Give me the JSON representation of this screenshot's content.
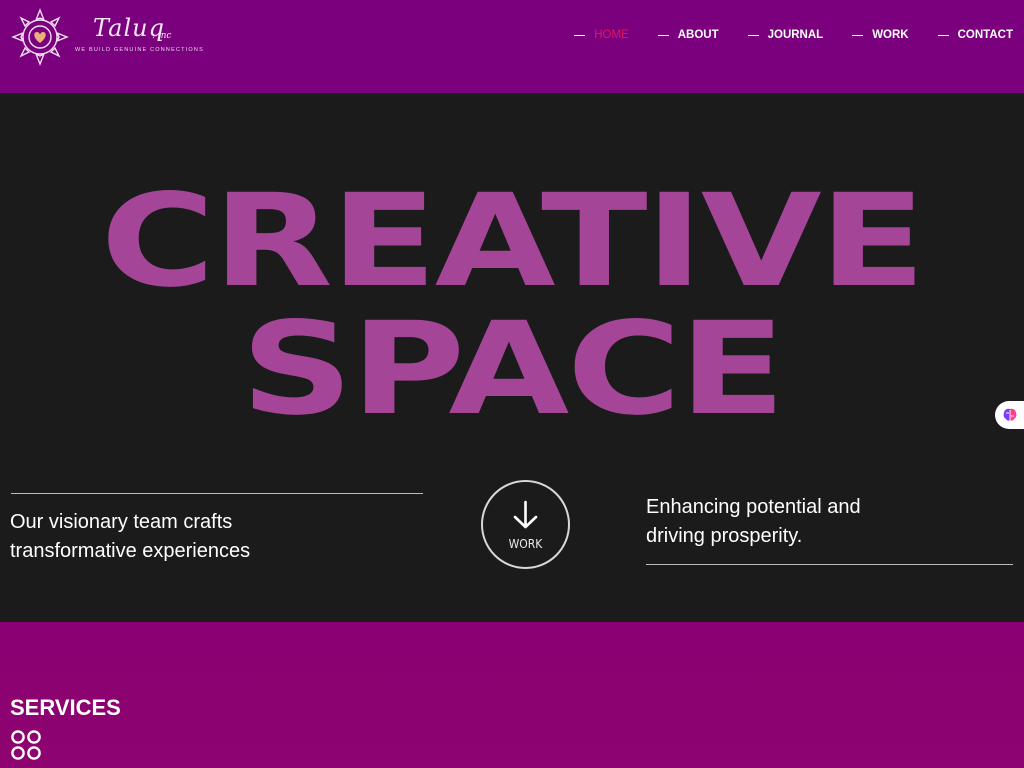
{
  "brand": {
    "name": "Taluq",
    "suffix": ". inc",
    "tagline": "WE BUILD GENUINE CONNECTIONS",
    "accent": "#7a007e",
    "logo_icon": "mandala-icon"
  },
  "nav": {
    "items": [
      {
        "label": "HOME",
        "active": true
      },
      {
        "label": "ABOUT",
        "active": false
      },
      {
        "label": "JOURNAL",
        "active": false
      },
      {
        "label": "WORK",
        "active": false
      },
      {
        "label": "CONTACT",
        "active": false
      }
    ],
    "active_color": "#e4145c"
  },
  "hero": {
    "line1": "CREATIVE",
    "line2": "SPACE",
    "title_color": "#a44598",
    "background": "#1b1b1b",
    "left_text_1": "Our visionary team crafts",
    "left_text_2": "transformative experiences",
    "right_text_1": "Enhancing potential and",
    "right_text_2": "driving prosperity.",
    "work_button": {
      "label": "WORK",
      "icon": "arrow-down-icon"
    }
  },
  "side_widget": {
    "icon": "brain-icon"
  },
  "services": {
    "title": "SERVICES",
    "icon": "four-circles-icon",
    "background": "#8b0072"
  }
}
